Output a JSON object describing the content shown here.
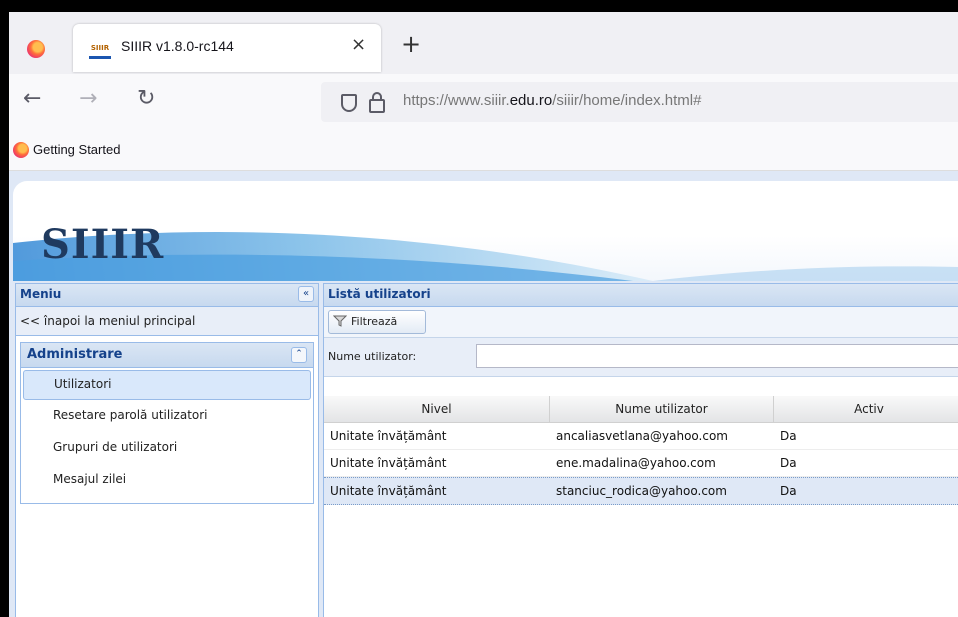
{
  "browser": {
    "tab_title": "SIIIR v1.8.0-rc144",
    "tab_close": "×",
    "new_tab": "+",
    "favicon_text": "SIIIR",
    "url_prefix": "https://www.siiir.",
    "url_domain": "edu.ro",
    "url_suffix": "/siiir/home/index.html#",
    "nav_back": "←",
    "nav_forward": "→",
    "nav_reload": "↻",
    "bookmark": "Getting Started"
  },
  "app": {
    "logo": "SIIIR",
    "menu": {
      "title": "Meniu",
      "collapse": "«",
      "back_link": "<< înapoi la meniul principal",
      "section_title": "Administrare",
      "section_toggle": "⌃",
      "items": [
        {
          "label": "Utilizatori",
          "selected": true
        },
        {
          "label": "Resetare parolă utilizatori",
          "selected": false
        },
        {
          "label": "Grupuri de utilizatori",
          "selected": false
        },
        {
          "label": "Mesajul zilei",
          "selected": false
        }
      ]
    },
    "list": {
      "title": "Listă utilizatori",
      "filter_button": "Filtrează",
      "filter_field_label": "Nume utilizator:",
      "filter_value": "",
      "columns": [
        "Nivel",
        "Nume utilizator",
        "Activ"
      ],
      "rows": [
        [
          "Unitate învățământ",
          "ancaliasvetlana@yahoo.com",
          "Da"
        ],
        [
          "Unitate învățământ",
          "ene.madalina@yahoo.com",
          "Da"
        ],
        [
          "Unitate învățământ",
          "stanciuc_rodica@yahoo.com",
          "Da"
        ]
      ]
    }
  }
}
